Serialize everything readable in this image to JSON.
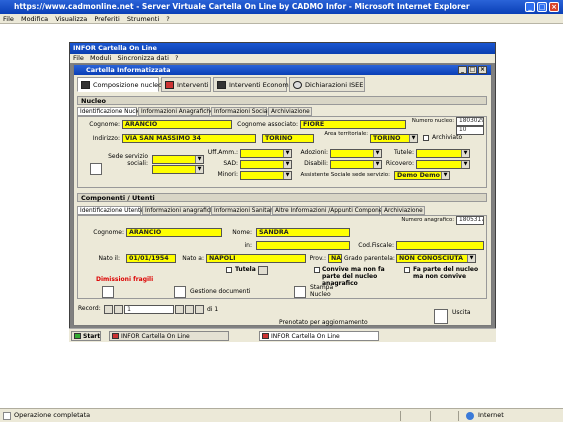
{
  "browser": {
    "title": "https://www.cadmonline.net - Server Virtuale Cartella On Line by CADMO Infor - Microsoft Internet Explorer",
    "menu": [
      "File",
      "Modifica",
      "Visualizza",
      "Preferiti",
      "Strumenti",
      "?"
    ],
    "status_text": "Operazione completata",
    "zone_text": "Internet"
  },
  "app": {
    "title": "INFOR Cartella On Line",
    "menu": [
      "File",
      "Moduli",
      "Sincronizza dati",
      "?"
    ]
  },
  "child": {
    "title": "Cartella Informatizzata",
    "tabs": [
      "Composizione nucleo",
      "Interventi",
      "Interventi Economici",
      "Dichiarazioni ISEE"
    ]
  },
  "nucleo": {
    "section": "Nucleo",
    "subtabs": [
      "Identificazione Nucleo",
      "Informazioni Anagrafiche",
      "Informazioni Sociali",
      "Archiviazione"
    ],
    "cognome_label": "Cognome:",
    "cognome": "ARANCIO",
    "cognome_assoc_label": "Cognome associato:",
    "cognome_assoc": "FIORE",
    "numero_label": "Numero nucleo:",
    "numero": "1803029",
    "numero2": "10",
    "indirizzo_label": "Indirizzo:",
    "indirizzo": "VIA SAN MASSIMO 34",
    "citta": "TORINO",
    "area_label": "Area territoriale:",
    "area": "TORINO",
    "archiviato_label": "Archiviato",
    "sede_label": "Sede servizio sociali:",
    "uff_label": "Uff.Amm.:",
    "sad_label": "SAD:",
    "minori_label": "Minori:",
    "adozioni_label": "Adozioni:",
    "disabili_label": "Disabili:",
    "anziani_label": "Anziani:",
    "tutele_label": "Tutele:",
    "ricovero_label": "Ricovero:",
    "assistente_label": "Assistente Sociale sede servizio:",
    "assistente": "Demo Demo"
  },
  "componenti": {
    "section": "Componenti / Utenti",
    "subtabs": [
      "Identificazione Utente",
      "Informazioni anagrafiche",
      "Informazioni Sanitarie",
      "Altre Informazioni /Appunti Componente",
      "Archiviazione"
    ],
    "numero_anag_label": "Numero anagrafico:",
    "numero_anag": "1805317",
    "cognome_label": "Cognome:",
    "cognome": "ARANCIO",
    "nome_label": "Nome:",
    "nome": "SANDRA",
    "in_label": "in:",
    "cod_fiscale_label": "Cod.Fiscale:",
    "nato_il_label": "Nato il:",
    "nato_il": "01/01/1954",
    "nato_a_label": "Nato a:",
    "nato_a": "NAPOLI",
    "prov_label": "Prov.:",
    "prov": "NA",
    "grado_label": "Grado parentela:",
    "grado": "NON CONOSCIUTA",
    "tutela_label": "Tutela",
    "convive_label": "Convive ma non fa parte del nucleo anagrafico",
    "fa_parte_label": "Fa parte del nucleo ma non convive",
    "dimissioni": "Dimissioni fragili",
    "gestione": "Gestione documenti",
    "stampa": "Stampa Nucleo"
  },
  "nav": {
    "record_label": "Record:",
    "record_value": "1",
    "of_text": "di 1",
    "prenotato": "Prenotato per aggiornamento",
    "uscita": "Uscita"
  },
  "taskbar": {
    "start": "Start",
    "item1": "INFOR Cartella On Line",
    "item2": "INFOR Cartella On Line"
  }
}
